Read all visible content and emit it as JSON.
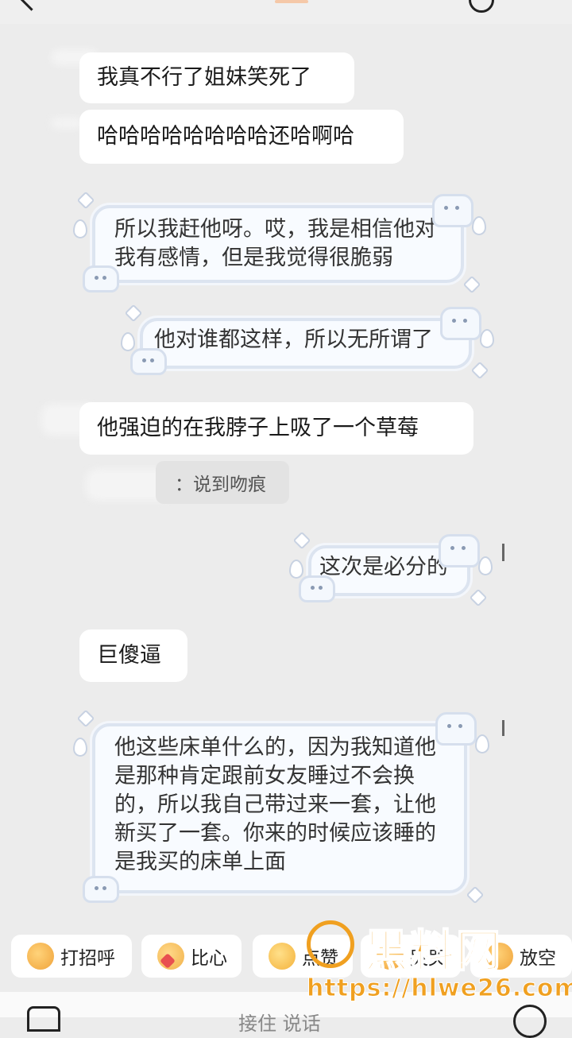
{
  "messages": [
    {
      "text": "我真不行了姐妹笑死了"
    },
    {
      "text": "哈哈哈哈哈哈哈哈还哈啊哈"
    },
    {
      "text": "所以我赶他呀。哎，我是相信他对\n我有感情，但是我觉得很脆弱"
    },
    {
      "text": "他对谁都这样，所以无所谓了"
    },
    {
      "text": "他强迫的在我脖子上吸了一个草莓"
    },
    {
      "text": "这次是必分的"
    },
    {
      "text": "巨傻逼"
    },
    {
      "text": "他这些床单什么的，因为我知道他\n是那种肯定跟前女友睡过不会换\n的，所以我自己带过来一套，让他\n新买了一套。你来的时候应该睡的\n是我买的床单上面"
    }
  ],
  "quote_reply": "：说到吻痕",
  "quick_replies": [
    "打招呼",
    "比心",
    "点赞",
    "哭哭",
    "放空"
  ],
  "input_hint": "接住 说话",
  "watermark": {
    "brand": "黑料网",
    "url": "https://hlwe26.com"
  },
  "colors": {
    "background": "#ececec",
    "bubble": "#ffffff",
    "cute_border": "#dce4f0",
    "watermark": "#f0a020"
  }
}
